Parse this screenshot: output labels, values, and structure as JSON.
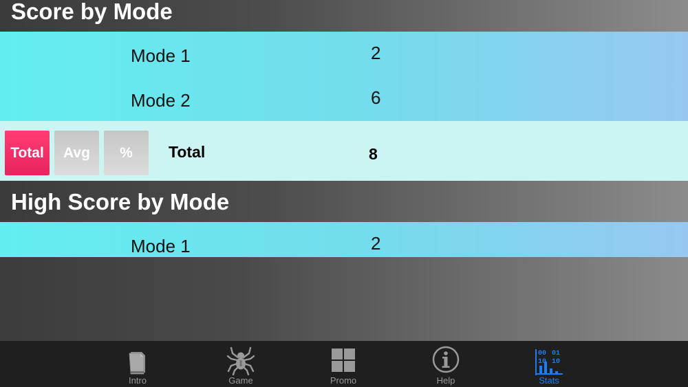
{
  "score_section": {
    "title": "Score by Mode",
    "rows": [
      {
        "label": "Mode 1",
        "value": "2"
      },
      {
        "label": "Mode 2",
        "value": "6"
      }
    ],
    "toggles": {
      "total": "Total",
      "avg": "Avg",
      "pct": "%"
    },
    "total_label": "Total",
    "total_value": "8"
  },
  "high_section": {
    "title": "High Score by Mode",
    "rows": [
      {
        "label": "Mode 1",
        "value": "2"
      }
    ]
  },
  "tabbar": {
    "tabs": [
      {
        "label": "Intro",
        "icon": "book-icon"
      },
      {
        "label": "Game",
        "icon": "spider-icon"
      },
      {
        "label": "Promo",
        "icon": "grid-icon"
      },
      {
        "label": "Help",
        "icon": "info-icon"
      },
      {
        "label": "Stats",
        "icon": "stats-icon",
        "active": true
      }
    ],
    "stats_icon_digits": [
      "00",
      "01",
      "10",
      "10"
    ]
  },
  "colors": {
    "accent": "#1e7cf2",
    "toggle_active": "#f0306a",
    "toggle_inactive": "#d0d0d0",
    "row_band_start": "#62eef0",
    "row_band_end": "#97c7f0",
    "total_band": "#ccf4f2"
  }
}
